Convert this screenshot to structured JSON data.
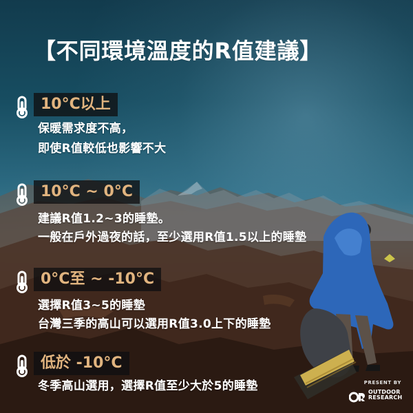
{
  "title": "【不同環境溫度的R值建議】",
  "sections": [
    {
      "temp_label": "10°C以上",
      "lines": [
        "保暖需求度不高，",
        "即使R值較低也影響不大"
      ]
    },
    {
      "temp_label": "10°C ~ 0°C",
      "lines": [
        "建議R值1.2~3的睡墊。",
        "一般在戶外過夜的話，至少選用R值1.5以上的睡墊"
      ]
    },
    {
      "temp_label": "0°C至 ~ -10°C",
      "lines": [
        "選擇R值3~5的睡墊",
        "台灣三季的高山可以選用R值3.0上下的睡墊"
      ]
    },
    {
      "temp_label": "低於  -10°C",
      "lines": [
        "冬季高山選用，選擇R值至少大於5的睡墊"
      ]
    }
  ],
  "branding": {
    "present_by": "PRESENT BY",
    "brand_name_line1": "OUTDOOR",
    "brand_name_line2": "RESEARCH"
  },
  "colors": {
    "accent": "#e1b47f",
    "label_background": "#0f1011",
    "text": "#ffffff",
    "sky_top": "#123b4d",
    "sky_mid": "#2f6e86",
    "ground_dark": "#332015",
    "jacket_blue": "#2d67b9"
  },
  "icons": {
    "temperature": "thermometer-icon",
    "brand": "or-logo-icon"
  }
}
